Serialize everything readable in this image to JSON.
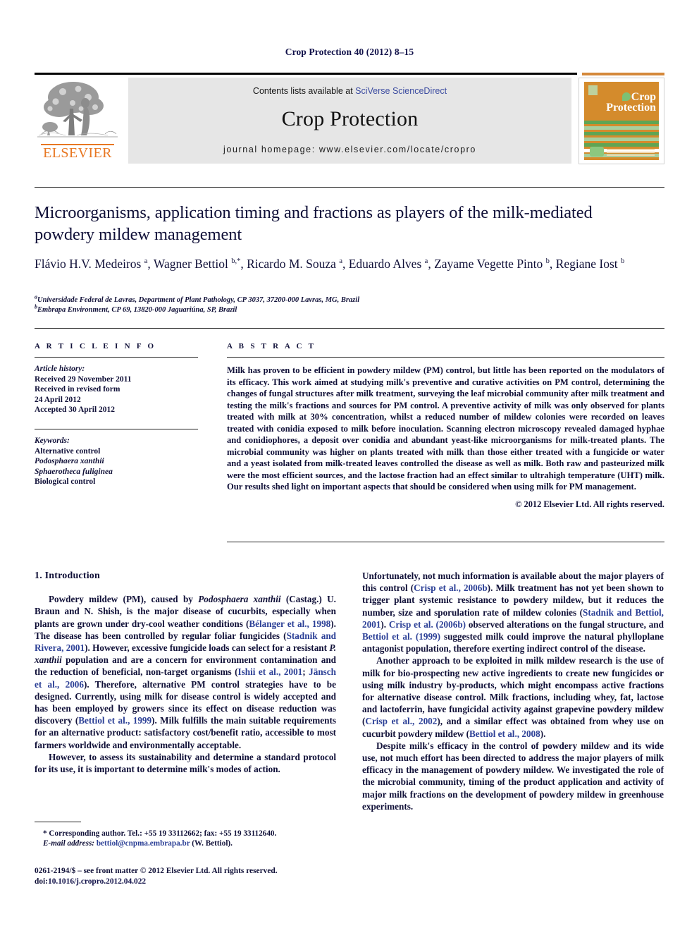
{
  "running_head": "Crop Protection 40 (2012) 8–15",
  "masthead": {
    "publisher_name": "ELSEVIER",
    "contents_prefix": "Contents lists available at ",
    "sciencedirect_link": "SciVerse ScienceDirect",
    "journal_title": "Crop Protection",
    "homepage": "journal homepage: www.elsevier.com/locate/cropro",
    "cover": {
      "title_line1": "Crop",
      "title_line2": "Protection",
      "stripe_colors": [
        "#5fa554",
        "#a8cf9e",
        "#5fa554",
        "#a8cf9e",
        "#5fa554",
        "#ffffff",
        "#a8cf9e"
      ]
    },
    "colors": {
      "elsevier_orange": "#e87722",
      "sciencedirect_blue": "#3b4ba0",
      "banner_gray": "#e6e6e6",
      "cover_orange": "#d48b2c"
    }
  },
  "article": {
    "title": "Microorganisms, application timing and fractions as players of the milk-mediated powdery mildew management",
    "authors_html": "Flávio H.V. Medeiros <sup>a</sup>, Wagner Bettiol <sup>b,*</sup>, Ricardo M. Souza <sup>a</sup>, Eduardo Alves <sup>a</sup>, Zayame Vegette Pinto <sup>b</sup>, Regiane Iost <sup>b</sup>",
    "affiliation_a": "Universidade Federal de Lavras, Department of Plant Pathology, CP 3037, 37200-000 Lavras, MG, Brazil",
    "affiliation_b": "Embrapa Environment, CP 69, 13820-000 Jaguariúna, SP, Brazil"
  },
  "info": {
    "heading": "A R T I C L E   I N F O",
    "history_label": "Article history:",
    "history_lines": [
      "Received 29 November 2011",
      "Received in revised form",
      "24 April 2012",
      "Accepted 30 April 2012"
    ],
    "keywords_label": "Keywords:",
    "keywords": [
      "Alternative control",
      "Podosphaera xanthii",
      "Sphaerotheca fuliginea",
      "Biological control"
    ]
  },
  "abstract": {
    "heading": "A B S T R A C T",
    "text": "Milk has proven to be efficient in powdery mildew (PM) control, but little has been reported on the modulators of its efficacy. This work aimed at studying milk's preventive and curative activities on PM control, determining the changes of fungal structures after milk treatment, surveying the leaf microbial community after milk treatment and testing the milk's fractions and sources for PM control. A preventive activity of milk was only observed for plants treated with milk at 30% concentration, whilst a reduced number of mildew colonies were recorded on leaves treated with conidia exposed to milk before inoculation. Scanning electron microscopy revealed damaged hyphae and conidiophores, a deposit over conidia and abundant yeast-like microorganisms for milk-treated plants. The microbial community was higher on plants treated with milk than those either treated with a fungicide or water and a yeast isolated from milk-treated leaves controlled the disease as well as milk. Both raw and pasteurized milk were the most efficient sources, and the lactose fraction had an effect similar to ultrahigh temperature (UHT) milk. Our results shed light on important aspects that should be considered when using milk for PM management.",
    "copyright": "© 2012 Elsevier Ltd. All rights reserved."
  },
  "introduction": {
    "heading": "1. Introduction",
    "left_paragraphs_html": [
      "Powdery mildew (PM), caused by <span class=\"ital\">Podosphaera xanthii</span> (Castag.) U. Braun and N. Shish, is the major disease of cucurbits, especially when plants are grown under dry-cool weather conditions (<span class=\"ref\">Bélanger et al., 1998</span>). The disease has been controlled by regular foliar fungicides (<span class=\"ref\">Stadnik and Rivera, 2001</span>). However, excessive fungicide loads can select for a resistant <span class=\"ital\">P. xanthii</span> population and are a concern for environment contamination and the reduction of beneficial, non-target organisms (<span class=\"ref\">Ishii et al., 2001</span>; <span class=\"ref\">Jänsch et al., 2006</span>). Therefore, alternative PM control strategies have to be designed. Currently, using milk for disease control is widely accepted and has been employed by growers since its effect on disease reduction was discovery (<span class=\"ref\">Bettiol et al., 1999</span>). Milk fulfills the main suitable requirements for an alternative product: satisfactory cost/benefit ratio, accessible to most farmers worldwide and environmentally acceptable.",
      "However, to assess its sustainability and determine a standard protocol for its use, it is important to determine milk's modes of action."
    ],
    "right_paragraphs_html": [
      "Unfortunately, not much information is available about the major players of this control (<span class=\"ref\">Crisp et al., 2006b</span>). Milk treatment has not yet been shown to trigger plant systemic resistance to powdery mildew, but it reduces the number, size and sporulation rate of mildew colonies (<span class=\"ref\">Stadnik and Bettiol, 2001</span>). <span class=\"ref\">Crisp et al. (2006b)</span> observed alterations on the fungal structure, and <span class=\"ref\">Bettiol et al. (1999)</span> suggested milk could improve the natural phylloplane antagonist population, therefore exerting indirect control of the disease.",
      "Another approach to be exploited in milk mildew research is the use of milk for bio-prospecting new active ingredients to create new fungicides or using milk industry by-products, which might encompass active fractions for alternative disease control. Milk fractions, including whey, fat, lactose and lactoferrin, have fungicidal activity against grapevine powdery mildew (<span class=\"ref\">Crisp et al., 2002</span>), and a similar effect was obtained from whey use on cucurbit powdery mildew (<span class=\"ref\">Bettiol et al., 2008</span>).",
      "Despite milk's efficacy in the control of powdery mildew and its wide use, not much effort has been directed to address the major players of milk efficacy in the management of powdery mildew. We investigated the role of the microbial community, timing of the product application and activity of major milk fractions on the development of powdery mildew in greenhouse experiments."
    ]
  },
  "footnotes": {
    "corresponding_line": "* Corresponding author. Tel.: +55 19 33112662; fax: +55 19 33112640.",
    "email_label": "E-mail address:",
    "email": "bettiol@cnpma.embrapa.br",
    "email_suffix": "(W. Bettiol).",
    "front_matter": "0261-2194/$ – see front matter © 2012 Elsevier Ltd. All rights reserved.",
    "doi_prefix": "doi:",
    "doi": "10.1016/j.cropro.2012.04.022"
  }
}
